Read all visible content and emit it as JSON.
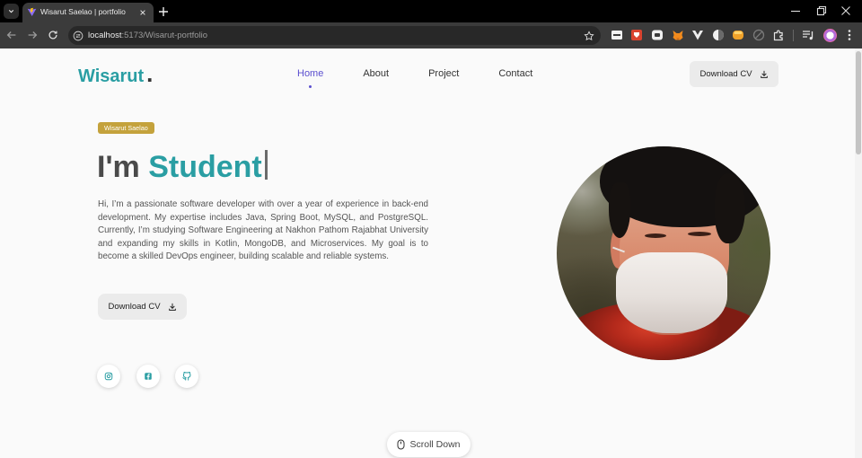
{
  "browser": {
    "tab_title": "Wisarut Saelao | portfolio",
    "favicon": "vite-favicon-icon",
    "url_host": "localhost",
    "url_path": ":5173/Wisarut-portfolio",
    "toolbar_icons": [
      "back-arrow-icon",
      "forward-arrow-icon",
      "reload-icon",
      "site-info-icon",
      "bookmark-star-icon"
    ],
    "extension_icons": [
      "extension-window-icon",
      "extension-red-icon",
      "extension-chat-icon",
      "fox-icon",
      "vue-devtools-icon",
      "dark-mode-icon",
      "extension-orange-icon",
      "extension-disabled-icon",
      "extensions-puzzle-icon",
      "media-controls-icon",
      "profile-avatar",
      "more-menu-icon"
    ],
    "window_controls": [
      "minimize-icon",
      "restore-icon",
      "close-icon"
    ]
  },
  "site": {
    "logo": "Wisarut",
    "logo_dot": ".",
    "nav": [
      {
        "label": "Home",
        "active": true
      },
      {
        "label": "About",
        "active": false
      },
      {
        "label": "Project",
        "active": false
      },
      {
        "label": "Contact",
        "active": false
      }
    ],
    "header_cta": "Download CV",
    "header_cta_icon": "download-icon"
  },
  "hero": {
    "badge": "Wisarut Saelao",
    "heading_prefix": "I'm",
    "heading_highlight": "Student",
    "description": "Hi, I’m a passionate software developer with over a year of experience in back-end development. My expertise includes Java, Spring Boot, MySQL, and PostgreSQL. Currently, I’m studying Software Engineering at Nakhon Pathom Rajabhat University and expanding my skills in Kotlin, MongoDB, and Microservices. My goal is to become a skilled DevOps engineer, building scalable and reliable systems.",
    "cta": "Download CV",
    "cta_icon": "download-icon",
    "socials": [
      "instagram-icon",
      "facebook-icon",
      "github-icon"
    ]
  },
  "scroll_hint": {
    "label": "Scroll Down",
    "icon": "mouse-icon"
  },
  "colors": {
    "accent": "#2a9ea3",
    "nav_active": "#5b4fcf",
    "badge_bg": "#c4a23c",
    "button_bg": "#ebebeb",
    "page_bg": "#fafafa",
    "text": "#555555",
    "heading": "#4a4a4a"
  }
}
